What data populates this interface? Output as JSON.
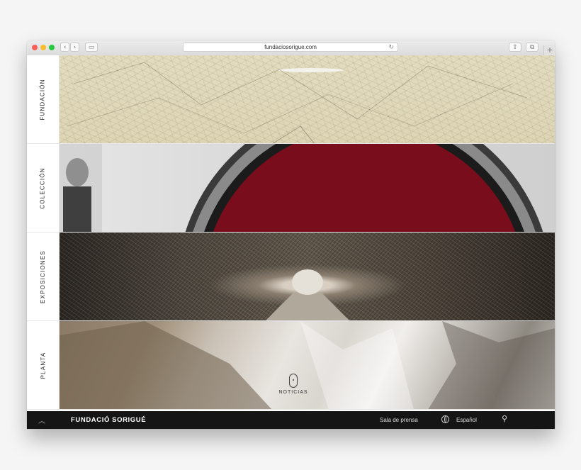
{
  "browser": {
    "url": "fundaciosorigue.com",
    "icons": [
      "back-icon",
      "forward-icon",
      "sidebar-icon",
      "reload-icon",
      "share-icon",
      "tabs-icon",
      "new-tab-icon"
    ]
  },
  "sections": [
    {
      "label": "FUNDACIÓN"
    },
    {
      "label": "COLECCIÓN"
    },
    {
      "label": "EXPOSICIONES"
    },
    {
      "label": "PLANTA"
    }
  ],
  "noticias": {
    "label": "NOTICIAS"
  },
  "footer": {
    "brand": "FUNDACIÓ SORIGUÉ",
    "press": "Sala de prensa",
    "language": "Español"
  },
  "colors": {
    "footer_bg": "#151515",
    "traffic_red": "#fc5f57",
    "traffic_yellow": "#fdbc2e",
    "traffic_green": "#28c840",
    "collection_red": "#7a0d1c"
  }
}
